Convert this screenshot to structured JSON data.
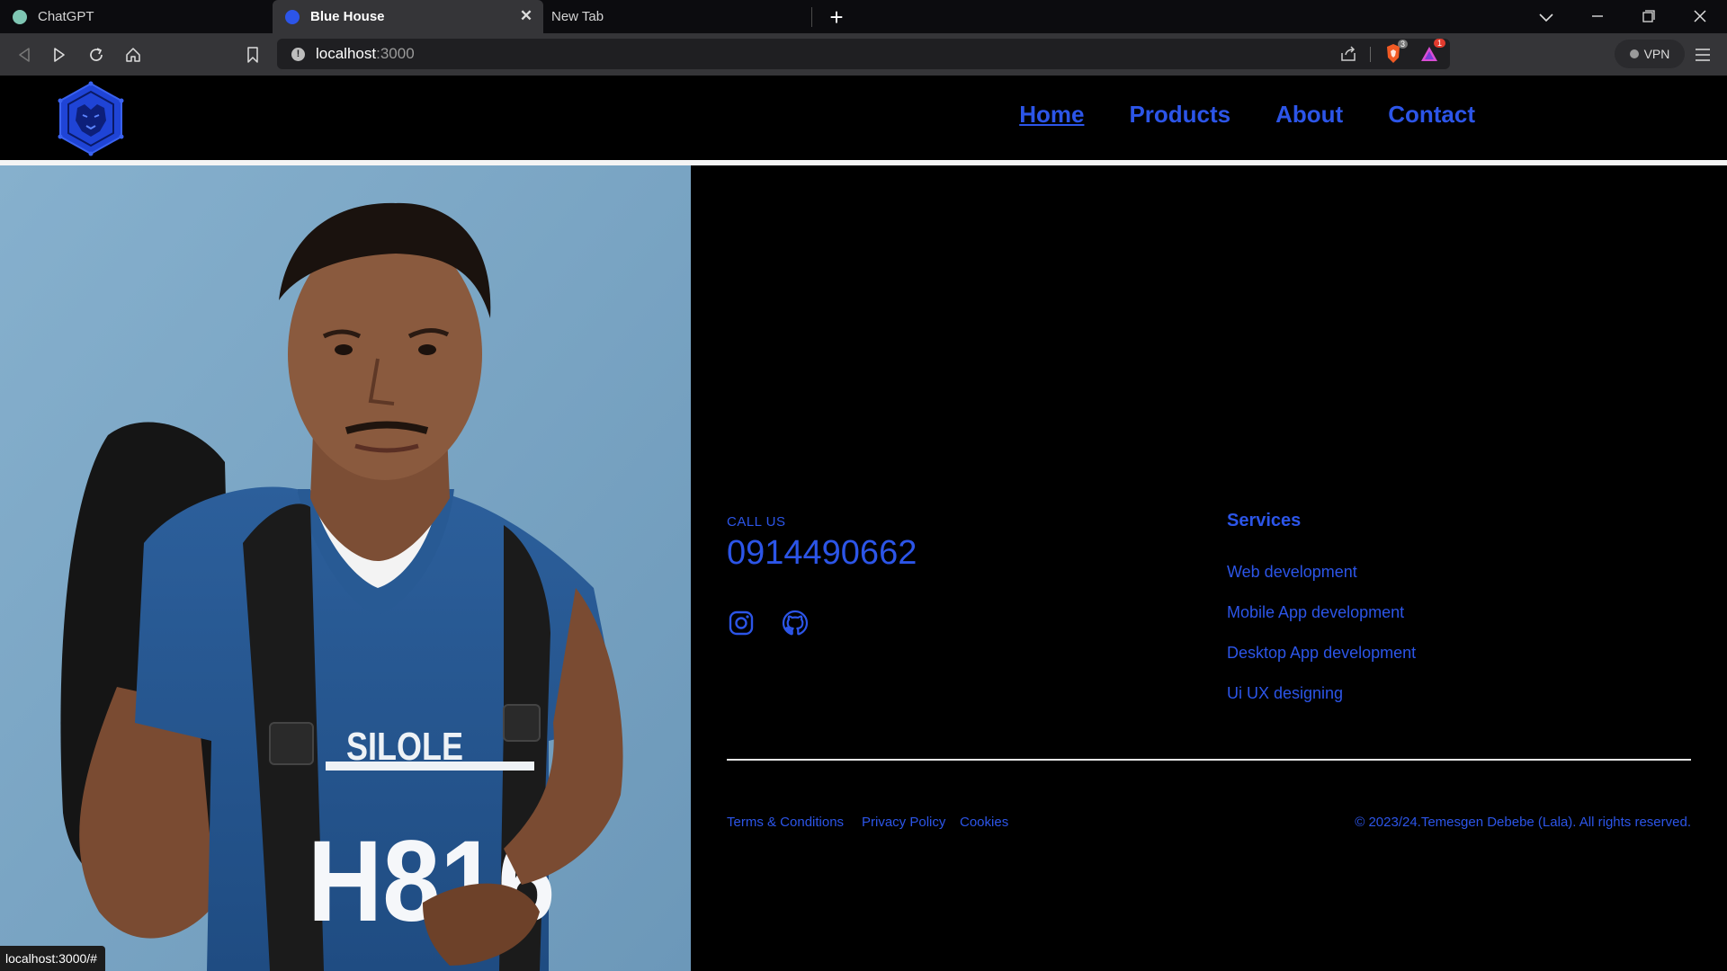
{
  "tabs": [
    {
      "title": "ChatGPT",
      "active": false,
      "favicon_color": "#7fc6b3",
      "favicon": "chatgpt-icon"
    },
    {
      "title": "Blue House",
      "active": true,
      "favicon_color": "#2c55e8",
      "favicon": "blue-house-icon"
    },
    {
      "title": "New Tab",
      "active": false
    }
  ],
  "toolbar": {
    "url_host": "localhost",
    "url_port": ":3000",
    "vpn_label": "VPN",
    "brave_shield_count": "3",
    "rewards_count": "1"
  },
  "site": {
    "nav": [
      {
        "label": "Home",
        "active": true
      },
      {
        "label": "Products",
        "active": false
      },
      {
        "label": "About",
        "active": false
      },
      {
        "label": "Contact",
        "active": false
      }
    ],
    "brand_color": "#2c55e8"
  },
  "hero": {
    "shirt_text_top": "SILOLE",
    "shirt_text_main": "H816"
  },
  "footer": {
    "call_label": "CALL US",
    "phone": "0914490662",
    "social": [
      "instagram-icon",
      "github-icon"
    ],
    "services_title": "Services",
    "services": [
      "Web development",
      "Mobile App development",
      "Desktop App development",
      "Ui UX designing"
    ],
    "legal_links": [
      "Terms & Conditions",
      "Privacy Policy",
      "Cookies"
    ],
    "copyright": "© 2023/24.Temesgen Debebe (Lala). All rights reserved."
  },
  "status_bar": {
    "hover_url": "localhost:3000/#"
  }
}
